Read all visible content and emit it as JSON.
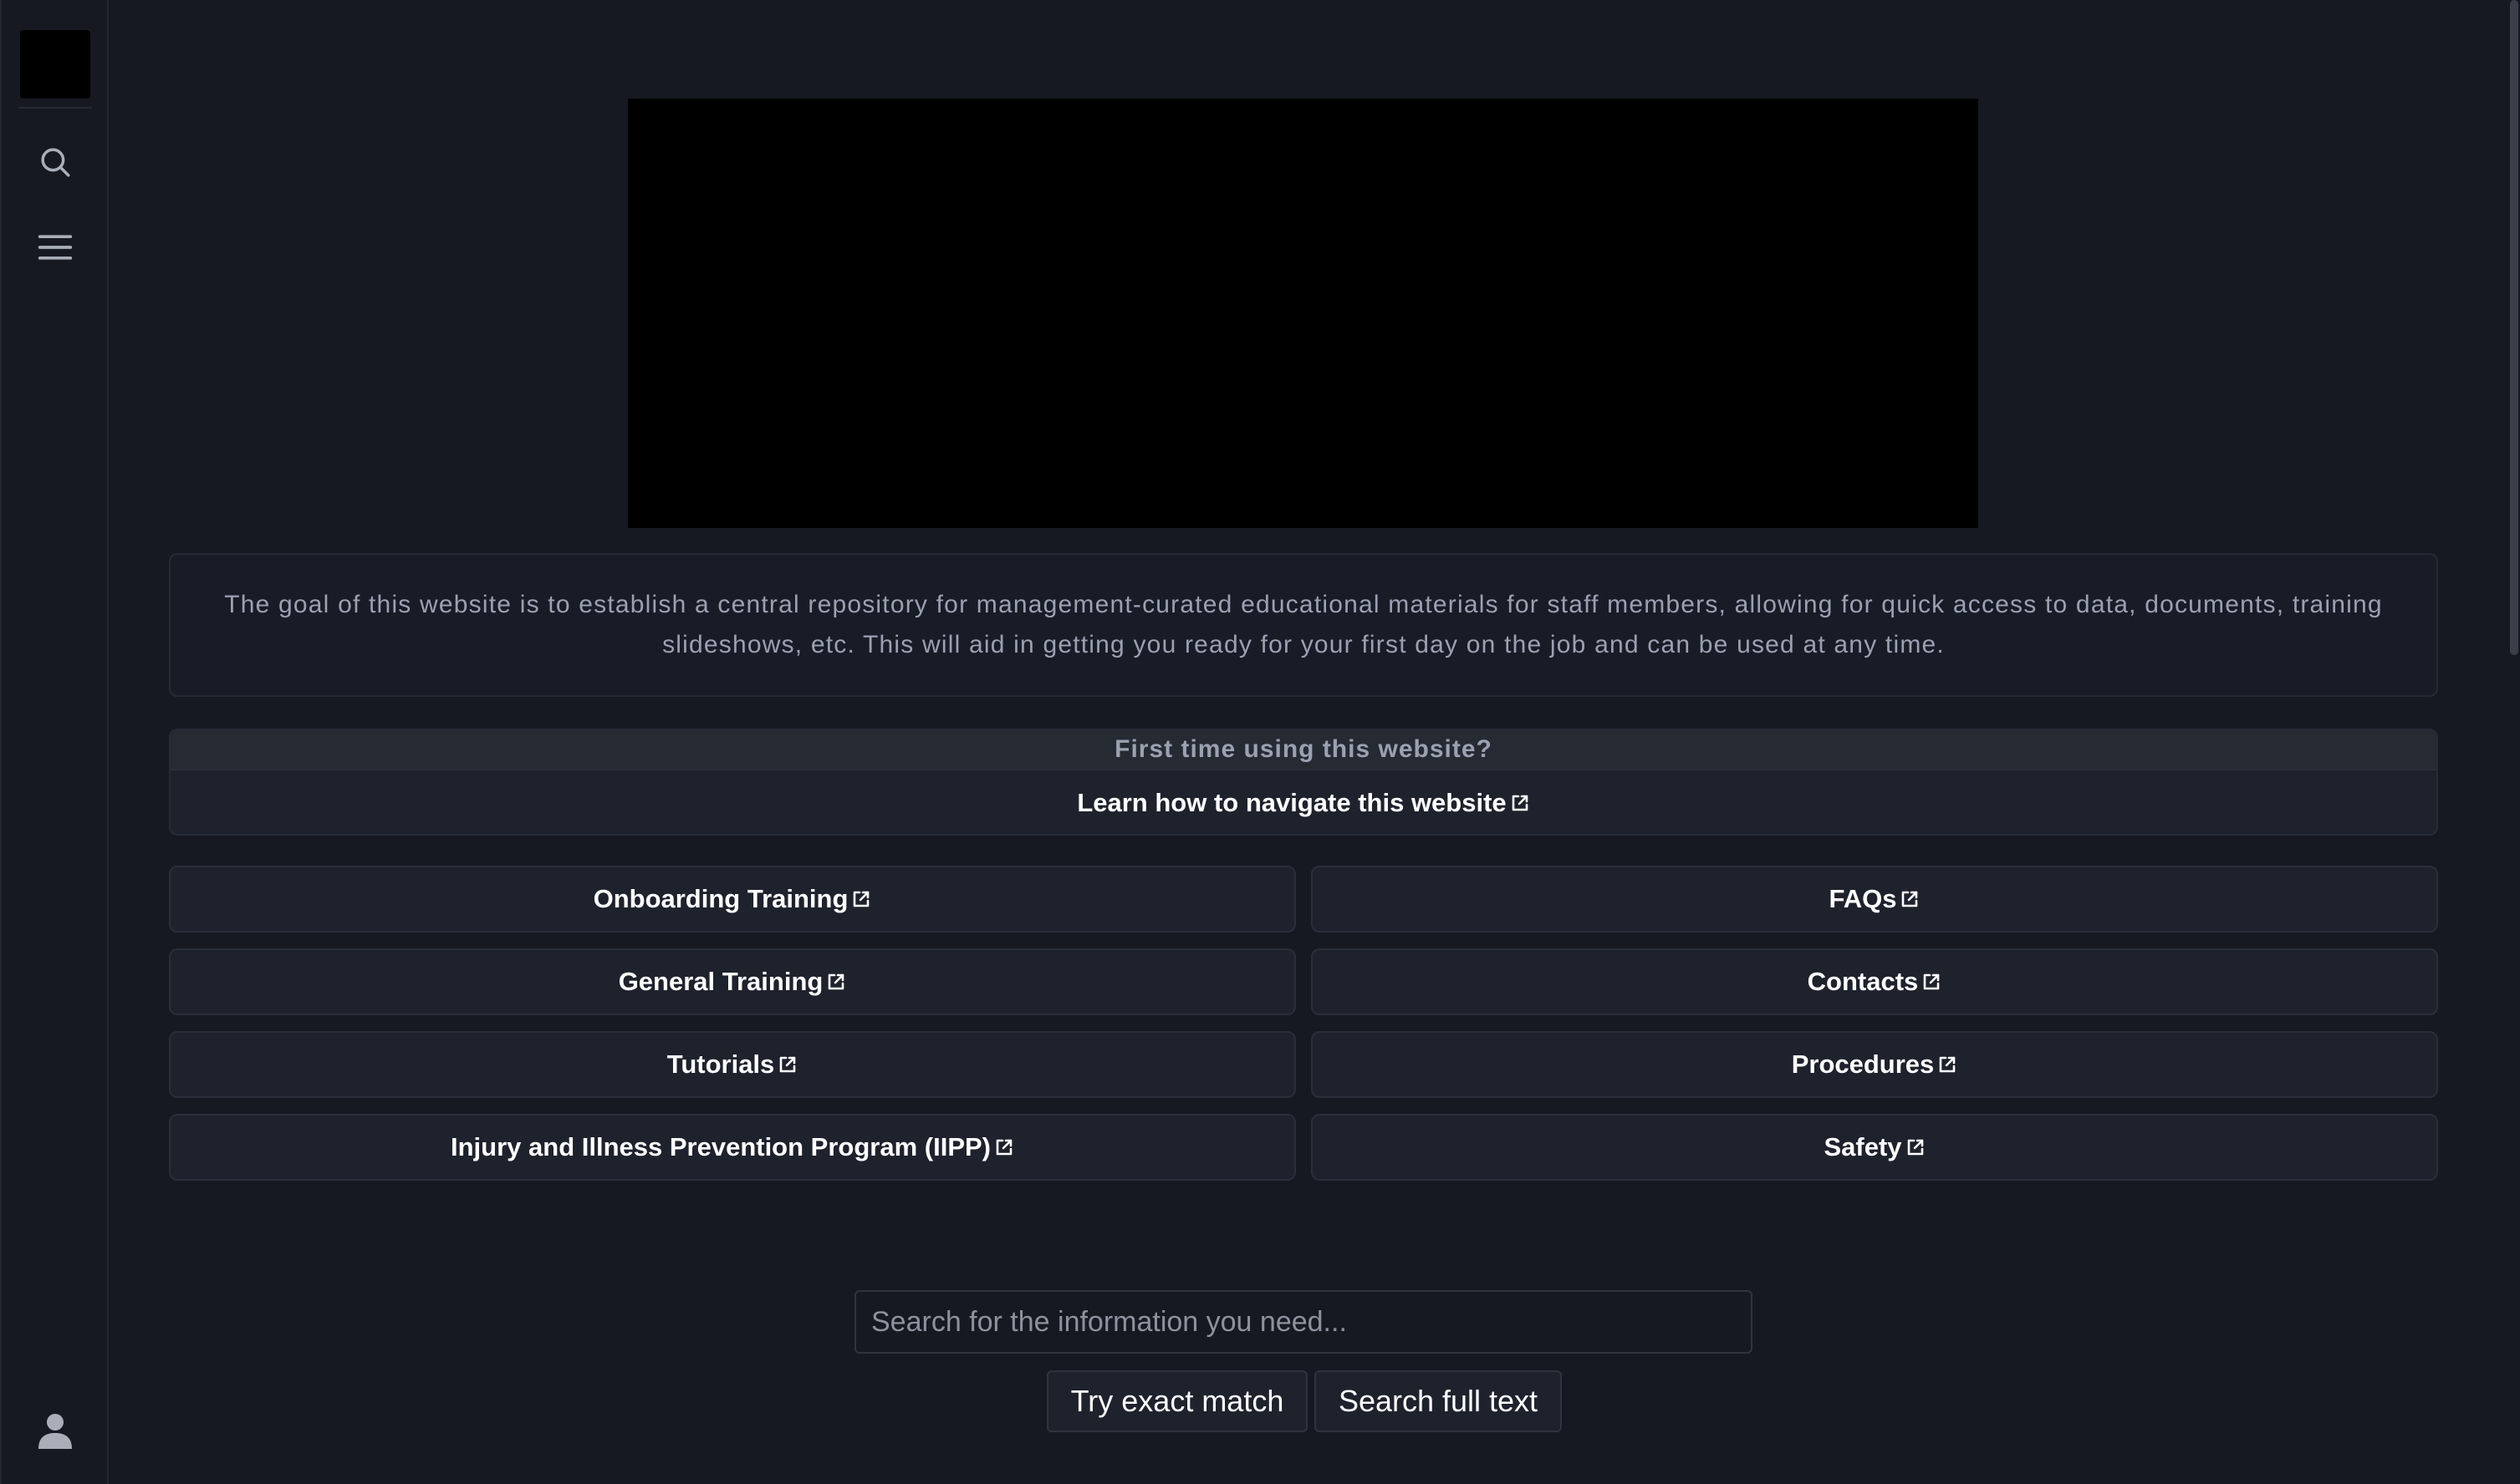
{
  "sidebar": {
    "icons": [
      "search-icon",
      "menu-icon",
      "user-icon"
    ]
  },
  "intro": {
    "text": "The goal of this website is to establish a central repository for management-curated educational materials for staff members, allowing for quick access to data, documents, training slideshows, etc. This will aid in getting you ready for your first day on the job and can be used at any time."
  },
  "first_time": {
    "header": "First time using this website?",
    "link_label": "Learn how to navigate this website"
  },
  "links": {
    "left": [
      "Onboarding Training",
      "General Training",
      "Tutorials",
      "Injury and Illness Prevention Program (IIPP)"
    ],
    "right": [
      "FAQs",
      "Contacts",
      "Procedures",
      "Safety"
    ]
  },
  "search": {
    "placeholder": "Search for the information you need...",
    "exact_label": "Try exact match",
    "full_label": "Search full text"
  },
  "colors": {
    "background": "#161922",
    "card": "#1e222d",
    "muted_text": "#9aa1b2"
  }
}
